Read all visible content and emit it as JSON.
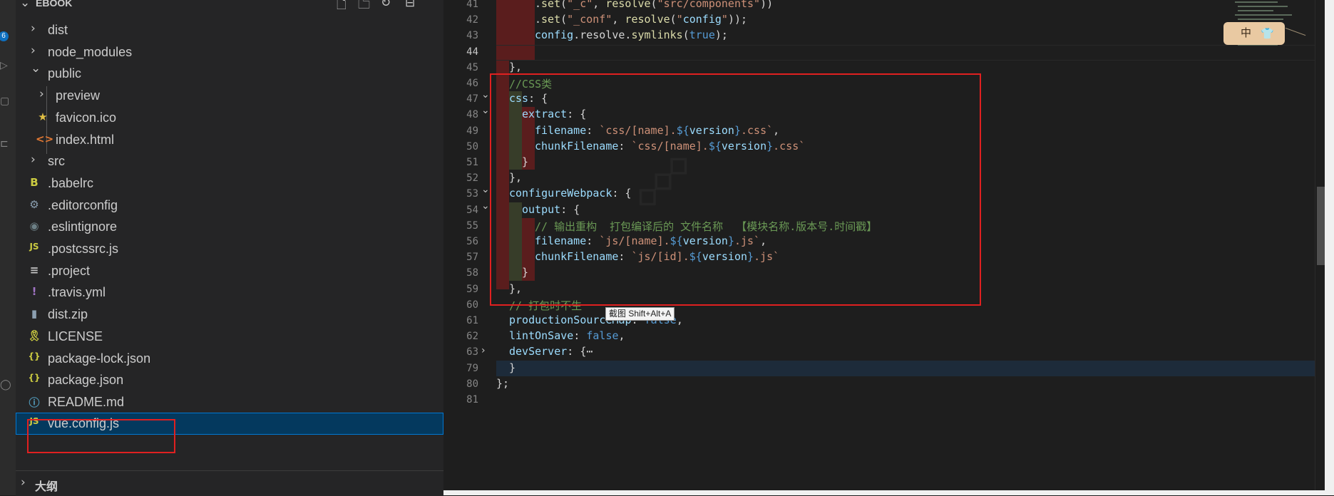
{
  "explorer": {
    "title": "EBOOK",
    "tree": [
      {
        "label": "dist",
        "type": "folder",
        "expanded": false,
        "icon": "chevron-right-icon"
      },
      {
        "label": "node_modules",
        "type": "folder",
        "expanded": false,
        "icon": "chevron-right-icon"
      },
      {
        "label": "public",
        "type": "folder",
        "expanded": true,
        "icon": "chevron-down-icon"
      },
      {
        "label": "preview",
        "type": "folder",
        "expanded": false,
        "icon": "chevron-right-icon"
      },
      {
        "label": "favicon.ico",
        "type": "file",
        "icon": "star-icon",
        "icon_glyph": "★",
        "icon_color": "#e2c044"
      },
      {
        "label": "index.html",
        "type": "file",
        "icon": "html-icon",
        "icon_glyph": "<>",
        "icon_color": "#e37933"
      },
      {
        "label": "src",
        "type": "folder",
        "expanded": false,
        "icon": "chevron-right-icon"
      },
      {
        "label": ".babelrc",
        "type": "file",
        "icon": "babel-icon",
        "icon_glyph": "B",
        "icon_color": "#cbcb41"
      },
      {
        "label": ".editorconfig",
        "type": "file",
        "icon": "gear-icon",
        "icon_glyph": "⚙",
        "icon_color": "#8b9fb0"
      },
      {
        "label": ".eslintignore",
        "type": "file",
        "icon": "eslint-icon",
        "icon_glyph": "◉",
        "icon_color": "#6d8086"
      },
      {
        "label": ".postcssrc.js",
        "type": "file",
        "icon": "js-icon",
        "icon_glyph": "JS",
        "icon_color": "#cbcb41"
      },
      {
        "label": ".project",
        "type": "file",
        "icon": "lines-icon",
        "icon_glyph": "≡",
        "icon_color": "#c5c5c5"
      },
      {
        "label": ".travis.yml",
        "type": "file",
        "icon": "yaml-icon",
        "icon_glyph": "!",
        "icon_color": "#a074c4"
      },
      {
        "label": "dist.zip",
        "type": "file",
        "icon": "zip-icon",
        "icon_glyph": "▮",
        "icon_color": "#8b9fb0"
      },
      {
        "label": "LICENSE",
        "type": "file",
        "icon": "license-icon",
        "icon_glyph": "🎗",
        "icon_color": "#cbcb41"
      },
      {
        "label": "package-lock.json",
        "type": "file",
        "icon": "json-icon",
        "icon_glyph": "{}",
        "icon_color": "#cbcb41"
      },
      {
        "label": "package.json",
        "type": "file",
        "icon": "json-icon",
        "icon_glyph": "{}",
        "icon_color": "#cbcb41"
      },
      {
        "label": "README.md",
        "type": "file",
        "icon": "info-icon",
        "icon_glyph": "ⓘ",
        "icon_color": "#519aba"
      },
      {
        "label": "vue.config.js",
        "type": "file",
        "icon": "js-icon",
        "icon_glyph": "JS",
        "icon_color": "#cbcb41",
        "selected": true
      }
    ],
    "outline_label": "大纲"
  },
  "editor": {
    "line_numbers": [
      "41",
      "42",
      "43",
      "44",
      "45",
      "46",
      "47",
      "48",
      "49",
      "50",
      "51",
      "52",
      "53",
      "54",
      "55",
      "56",
      "57",
      "58",
      "59",
      "60",
      "61",
      "62",
      "63",
      "79",
      "80",
      "81"
    ],
    "active_line": "44",
    "lines": [
      ".set(\"_c\", resolve(\"src/components\"))",
      ".set(\"_conf\", resolve(\"config\"));",
      "config.resolve.symlinks(true);",
      "",
      "},",
      "//CSS类",
      "css: {",
      "extract: {",
      "filename: `css/[name].${version}.css`,",
      "chunkFilename: `css/[name].${version}.css`",
      "}",
      "},",
      "configureWebpack: {",
      "output: {",
      "// 输出重构  打包编译后的 文件名称  【模块名称.版本号.时间戳】",
      "filename: `js/[name].${version}.js`,",
      "chunkFilename: `js/[id].${version}.js`",
      "}",
      "},",
      "// 打包时不生",
      "productionSourceMap: false,",
      "lintOnSave: false,",
      "devServer: {⋯",
      "}",
      "};",
      ""
    ],
    "tooltip": "截图 Shift+Alt+A"
  },
  "ime": {
    "mode": "中",
    "skin_icon": "shirt-icon"
  },
  "colors": {
    "highlight_box": "#e02020",
    "selection": "#04395e",
    "diff_deleted": "#5a1d1d",
    "diff_added": "#373d29"
  }
}
